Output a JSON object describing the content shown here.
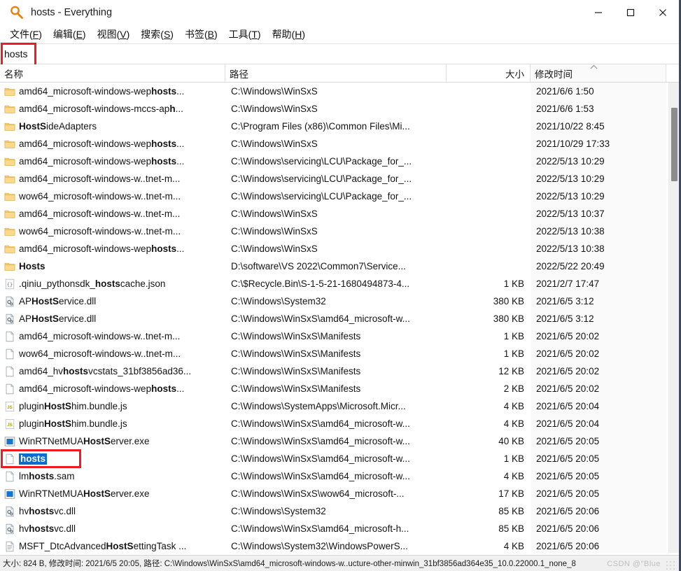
{
  "window": {
    "title": "hosts - Everything",
    "app_icon": "magnifier-icon",
    "minimize_label": "—",
    "maximize_label": "□",
    "close_label": "✕"
  },
  "menubar": {
    "items": [
      {
        "label": "文件(F)",
        "name": "menu-file"
      },
      {
        "label": "编辑(E)",
        "name": "menu-edit"
      },
      {
        "label": "视图(V)",
        "name": "menu-view"
      },
      {
        "label": "搜索(S)",
        "name": "menu-search"
      },
      {
        "label": "书签(B)",
        "name": "menu-bookmarks"
      },
      {
        "label": "工具(T)",
        "name": "menu-tools"
      },
      {
        "label": "帮助(H)",
        "name": "menu-help"
      }
    ]
  },
  "search": {
    "value": "hosts",
    "placeholder": ""
  },
  "columns": {
    "name": "名称",
    "path": "路径",
    "size": "大小",
    "date": "修改时间",
    "sort_indicator": "︿"
  },
  "rows": [
    {
      "icon": "folder-icon",
      "name_pre": "amd64_microsoft-windows-wep",
      "name_bold": "hosts",
      "name_post": "...",
      "path": "C:\\Windows\\WinSxS",
      "size": "",
      "date": "2021/6/6 1:50"
    },
    {
      "icon": "folder-icon",
      "name_pre": "amd64_microsoft-windows-mccs-ap",
      "name_bold": "h",
      "name_post": "...",
      "path": "C:\\Windows\\WinSxS",
      "size": "",
      "date": "2021/6/6 1:53"
    },
    {
      "icon": "folder-icon",
      "name_pre": "",
      "name_bold": "HostS",
      "name_post": "ideAdapters",
      "path": "C:\\Program Files (x86)\\Common Files\\Mi...",
      "size": "",
      "date": "2021/10/22 8:45"
    },
    {
      "icon": "folder-icon",
      "name_pre": "amd64_microsoft-windows-wep",
      "name_bold": "hosts",
      "name_post": "...",
      "path": "C:\\Windows\\WinSxS",
      "size": "",
      "date": "2021/10/29 17:33"
    },
    {
      "icon": "folder-icon",
      "name_pre": "amd64_microsoft-windows-wep",
      "name_bold": "hosts",
      "name_post": "...",
      "path": "C:\\Windows\\servicing\\LCU\\Package_for_...",
      "size": "",
      "date": "2022/5/13 10:29"
    },
    {
      "icon": "folder-icon",
      "name_pre": "amd64_microsoft-windows-w..tnet-m",
      "name_bold": "",
      "name_post": "...",
      "path": "C:\\Windows\\servicing\\LCU\\Package_for_...",
      "size": "",
      "date": "2022/5/13 10:29"
    },
    {
      "icon": "folder-icon",
      "name_pre": "wow64_microsoft-windows-w..tnet-m",
      "name_bold": "",
      "name_post": "...",
      "path": "C:\\Windows\\servicing\\LCU\\Package_for_...",
      "size": "",
      "date": "2022/5/13 10:29"
    },
    {
      "icon": "folder-icon",
      "name_pre": "amd64_microsoft-windows-w..tnet-m",
      "name_bold": "",
      "name_post": "...",
      "path": "C:\\Windows\\WinSxS",
      "size": "",
      "date": "2022/5/13 10:37"
    },
    {
      "icon": "folder-icon",
      "name_pre": "wow64_microsoft-windows-w..tnet-m",
      "name_bold": "",
      "name_post": "...",
      "path": "C:\\Windows\\WinSxS",
      "size": "",
      "date": "2022/5/13 10:38"
    },
    {
      "icon": "folder-icon",
      "name_pre": "amd64_microsoft-windows-wep",
      "name_bold": "hosts",
      "name_post": "...",
      "path": "C:\\Windows\\WinSxS",
      "size": "",
      "date": "2022/5/13 10:38"
    },
    {
      "icon": "folder-icon",
      "name_pre": "",
      "name_bold": "Hosts",
      "name_post": "",
      "path": "D:\\software\\VS 2022\\Common7\\Service...",
      "size": "",
      "date": "2022/5/22 20:49"
    },
    {
      "icon": "json-icon",
      "name_pre": ".qiniu_pythonsdk_",
      "name_bold": "hosts",
      "name_post": "cache.json",
      "path": "C:\\$Recycle.Bin\\S-1-5-21-1680494873-4...",
      "size": "1 KB",
      "date": "2021/2/7 17:47"
    },
    {
      "icon": "dll-icon",
      "name_pre": "AP",
      "name_bold": "HostS",
      "name_post": "ervice.dll",
      "path": "C:\\Windows\\System32",
      "size": "380 KB",
      "date": "2021/6/5 3:12"
    },
    {
      "icon": "dll-icon",
      "name_pre": "AP",
      "name_bold": "HostS",
      "name_post": "ervice.dll",
      "path": "C:\\Windows\\WinSxS\\amd64_microsoft-w...",
      "size": "380 KB",
      "date": "2021/6/5 3:12"
    },
    {
      "icon": "blank-file-icon",
      "name_pre": "amd64_microsoft-windows-w..tnet-m",
      "name_bold": "",
      "name_post": "...",
      "path": "C:\\Windows\\WinSxS\\Manifests",
      "size": "1 KB",
      "date": "2021/6/5 20:02"
    },
    {
      "icon": "blank-file-icon",
      "name_pre": "wow64_microsoft-windows-w..tnet-m",
      "name_bold": "",
      "name_post": "...",
      "path": "C:\\Windows\\WinSxS\\Manifests",
      "size": "1 KB",
      "date": "2021/6/5 20:02"
    },
    {
      "icon": "blank-file-icon",
      "name_pre": "amd64_hv",
      "name_bold": "hosts",
      "name_post": "vcstats_31bf3856ad36...",
      "path": "C:\\Windows\\WinSxS\\Manifests",
      "size": "12 KB",
      "date": "2021/6/5 20:02"
    },
    {
      "icon": "blank-file-icon",
      "name_pre": "amd64_microsoft-windows-wep",
      "name_bold": "hosts",
      "name_post": "...",
      "path": "C:\\Windows\\WinSxS\\Manifests",
      "size": "2 KB",
      "date": "2021/6/5 20:02"
    },
    {
      "icon": "js-icon",
      "name_pre": "plugin",
      "name_bold": "HostS",
      "name_post": "him.bundle.js",
      "path": "C:\\Windows\\SystemApps\\Microsoft.Micr...",
      "size": "4 KB",
      "date": "2021/6/5 20:04"
    },
    {
      "icon": "js-icon",
      "name_pre": "plugin",
      "name_bold": "HostS",
      "name_post": "him.bundle.js",
      "path": "C:\\Windows\\WinSxS\\amd64_microsoft-w...",
      "size": "4 KB",
      "date": "2021/6/5 20:04"
    },
    {
      "icon": "exe-icon",
      "name_pre": "WinRTNetMUA",
      "name_bold": "HostS",
      "name_post": "erver.exe",
      "path": "C:\\Windows\\WinSxS\\amd64_microsoft-w...",
      "size": "40 KB",
      "date": "2021/6/5 20:05"
    },
    {
      "icon": "blank-file-icon",
      "name_pre": "",
      "name_bold": "hosts",
      "name_post": "",
      "path": "C:\\Windows\\WinSxS\\amd64_microsoft-w...",
      "size": "1 KB",
      "date": "2021/6/5 20:05",
      "selected": true
    },
    {
      "icon": "blank-file-icon",
      "name_pre": "lm",
      "name_bold": "hosts",
      "name_post": ".sam",
      "path": "C:\\Windows\\WinSxS\\amd64_microsoft-w...",
      "size": "4 KB",
      "date": "2021/6/5 20:05"
    },
    {
      "icon": "exe-icon",
      "name_pre": "WinRTNetMUA",
      "name_bold": "HostS",
      "name_post": "erver.exe",
      "path": "C:\\Windows\\WinSxS\\wow64_microsoft-...",
      "size": "17 KB",
      "date": "2021/6/5 20:05"
    },
    {
      "icon": "dll-icon",
      "name_pre": "hv",
      "name_bold": "hosts",
      "name_post": "vc.dll",
      "path": "C:\\Windows\\System32",
      "size": "85 KB",
      "date": "2021/6/5 20:06"
    },
    {
      "icon": "dll-icon",
      "name_pre": "hv",
      "name_bold": "hosts",
      "name_post": "vc.dll",
      "path": "C:\\Windows\\WinSxS\\amd64_microsoft-h...",
      "size": "85 KB",
      "date": "2021/6/5 20:06"
    },
    {
      "icon": "text-file-icon",
      "name_pre": "MSFT_DtcAdvanced",
      "name_bold": "HostS",
      "name_post": "ettingTask ...",
      "path": "C:\\Windows\\System32\\WindowsPowerS...",
      "size": "4 KB",
      "date": "2021/6/5 20:06"
    }
  ],
  "statusbar": {
    "text": "大小: 824 B, 修改时间: 2021/6/5 20:05, 路径: C:\\Windows\\WinSxS\\amd64_microsoft-windows-w..ucture-other-minwin_31bf3856ad364e35_10.0.22000.1_none_8",
    "watermark": "CSDN @\"Blue"
  },
  "colors": {
    "selection": "#0a6ccc",
    "annotation": "#ee1c1c",
    "folder": "#ffc65c",
    "sorted_column_bg": "#fafafa",
    "window_border": "#3b4a5e"
  }
}
